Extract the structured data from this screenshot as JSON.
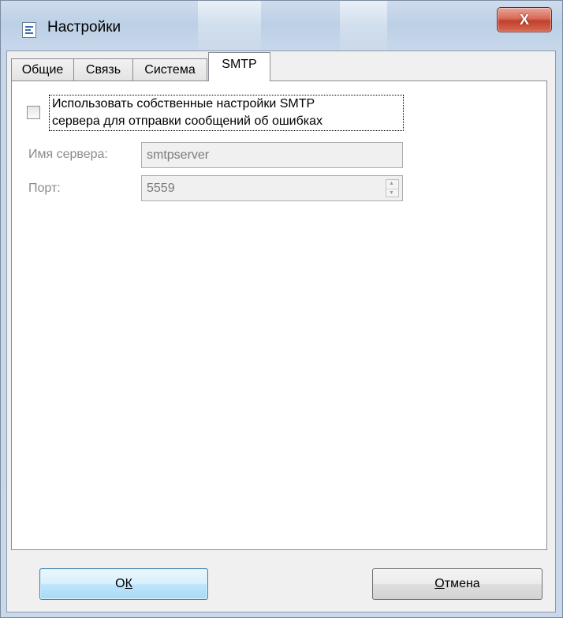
{
  "window": {
    "title": "Настройки",
    "close_glyph": "X",
    "icon": "settings-dialog-icon"
  },
  "tabs": [
    {
      "label": "Общие",
      "active": false
    },
    {
      "label": "Связь",
      "active": false
    },
    {
      "label": "Система",
      "active": false
    },
    {
      "label": "SMTP",
      "active": true
    }
  ],
  "smtp": {
    "use_custom_checkbox": {
      "checked": false,
      "label_line1": "Использовать собственные настройки SMTP",
      "label_line2": "сервера для отправки сообщений об ошибках"
    },
    "server": {
      "label": "Имя сервера:",
      "value": "smtpserver",
      "enabled": false
    },
    "port": {
      "label": "Порт:",
      "value": "5559",
      "enabled": false
    }
  },
  "buttons": {
    "ok_prefix": "О",
    "ok_mnemonic": "К",
    "cancel_mnemonic": "О",
    "cancel_rest": "тмена"
  },
  "colors": {
    "close_button": "#c2402c",
    "default_button_border": "#3c7fb1",
    "disabled_text": "#8a8a8a"
  }
}
